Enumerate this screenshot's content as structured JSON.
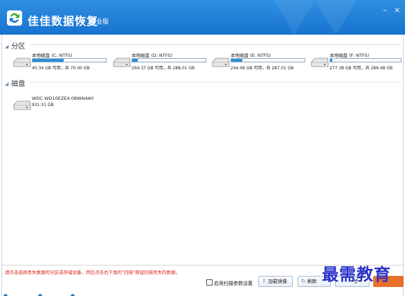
{
  "app": {
    "title": "佳佳数据恢复",
    "edition": "专业版",
    "minimize": "–",
    "close": "×"
  },
  "sections": {
    "partitions": "分区",
    "disks": "磁盘"
  },
  "partitions": [
    {
      "label": "本地磁盘 (C: NTFS)",
      "info": "40.34 GB 可用，共 70.00 GB",
      "used_fraction": 0.42
    },
    {
      "label": "本地磁盘 (D: NTFS)",
      "info": "264.37 GB 可用，共 288.01 GB",
      "used_fraction": 0.08
    },
    {
      "label": "本地磁盘 (E: NTFS)",
      "info": "244.06 GB 可用，共 287.01 GB",
      "used_fraction": 0.15
    },
    {
      "label": "本地磁盘 (F: NTFS)",
      "info": "277.38 GB 可用，共 286.48 GB",
      "used_fraction": 0.03
    }
  ],
  "disks": [
    {
      "label": "WDC WD10EZEX-08WN4A0",
      "info": "931.51 GB"
    }
  ],
  "footer": {
    "hint": "请点击选择丢失数据的分区或存储设备，然后点击右下角的\"扫描\"按钮扫描丢失的数据。",
    "scan_settings": "启用扫描参数设置",
    "load_image": "加载镜像",
    "refresh": "刷新",
    "next": "步"
  },
  "watermark": "最需教育",
  "colors": {
    "titlebar": "#1f80d8",
    "bar_fill": "#2d8fd6",
    "hint_text": "#d9261c",
    "action_button": "#e8702b",
    "watermark": "#2a33c8"
  }
}
